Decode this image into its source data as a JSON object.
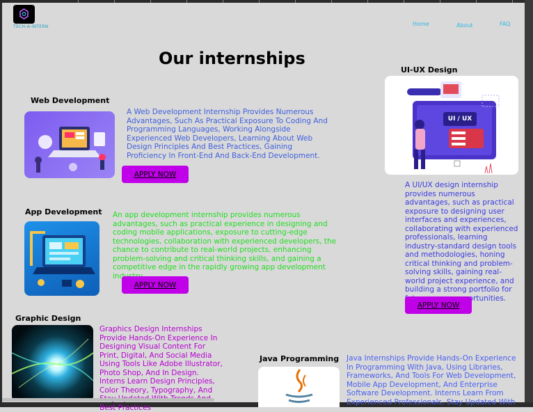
{
  "header": {
    "logo_text": "TECH-A-INTERN",
    "nav": [
      "Home",
      "About",
      "FAQ"
    ]
  },
  "page_title": "Our internships",
  "web_dev": {
    "title": "Web Development",
    "description": "A Web Development Internship Provides Numerous Advantages, Such As Practical Exposure To Coding And Programming Languages, Working Alongside Experienced Web Developers, Learning About Web Design Principles And Best Practices, Gaining Proficiency In Front-End And Back-End Development.",
    "apply": "APPLY NOW"
  },
  "uiux": {
    "title": "UI-UX Design",
    "badge": "UI / UX",
    "description": "A UI/UX design internship provides numerous advantages, such as practical exposure to designing user interfaces and experiences, collaborating with experienced professionals, learning industry-standard design tools and methodologies, honing critical thinking and problem-solving skills, gaining real-world project experience, and building a strong portfolio for future career opportunities.",
    "apply": "APPLY NOW"
  },
  "app_dev": {
    "title": "App Development",
    "description": "An app development internship provides numerous advantages, such as practical experience in designing and coding mobile applications, exposure to cutting-edge technologies, collaboration with experienced developers, the chance to contribute to real-world projects, enhancing problem-solving and critical thinking skills, and gaining a competitive edge in the rapidly growing app development industry",
    "apply": "APPLY NOW"
  },
  "graphic": {
    "title": "Graphic Design",
    "description": "Graphics Design Internships Provide Hands-On Experience In Designing Visual Content For Print, Digital, And Social Media Using Tools Like Adobe Illustrator, Photo Shop, And In Design. Interns Learn Design Principles, Color Theory, Typography, And Stay Updated With Trends And Best Practices"
  },
  "java": {
    "title": "Java Programming",
    "description": "Java Internships Provide Hands-On Experience In Programming With Java, Using Libraries, Frameworks, And Tools For Web Development, Mobile App Development, And Enterprise Software Development. Interns Learn From Experienced Professionals, Stay Updated With"
  },
  "colors": {
    "background": "#d9d9d9",
    "accent_button": "#c000e8",
    "web_text": "#3f5fdc",
    "uiux_text": "#3a3ae0",
    "app_text": "#22dd22",
    "graphic_text": "#b600d0",
    "java_text": "#4a60f0",
    "nav": "#30b8e0"
  }
}
